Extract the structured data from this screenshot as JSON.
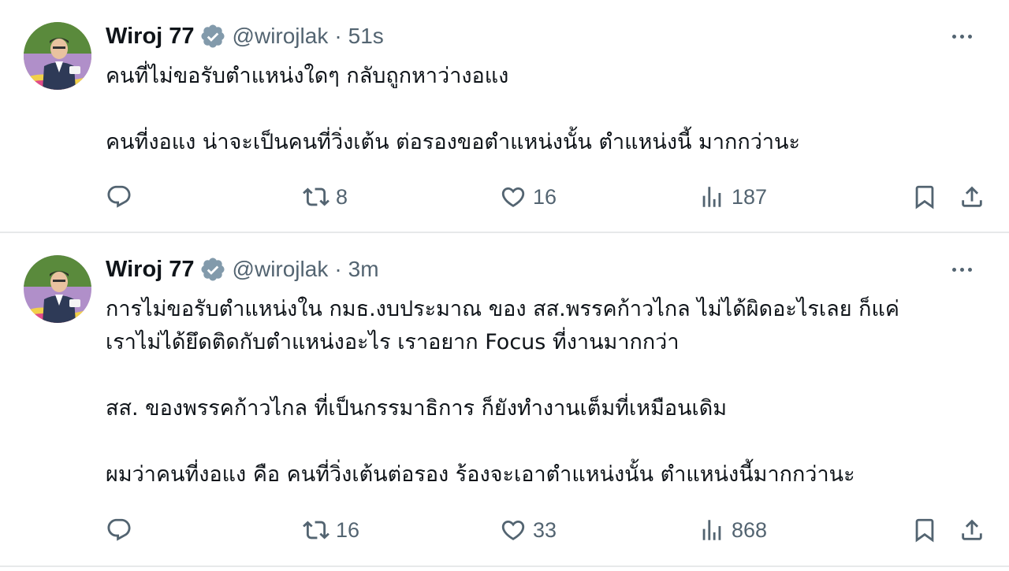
{
  "tweets": [
    {
      "author": {
        "name": "Wiroj 77",
        "handle": "@wirojlak",
        "separator": "·",
        "time": "51s"
      },
      "lines": [
        "คนที่ไม่ขอรับตำแหน่งใดๆ กลับถูกหาว่างอแง",
        "",
        "คนที่งอแง น่าจะเป็นคนที่วิ่งเต้น ต่อรองขอตำแหน่งนั้น ตำแหน่งนี้ มากกว่านะ"
      ],
      "stats": {
        "retweets": "8",
        "likes": "16",
        "views": "187"
      }
    },
    {
      "author": {
        "name": "Wiroj 77",
        "handle": "@wirojlak",
        "separator": "·",
        "time": "3m"
      },
      "lines": [
        "การไม่ขอรับตำแหน่งใน กมธ.งบประมาณ ของ สส.พรรคก้าวไกล ไม่ได้ผิดอะไรเลย ก็แค่",
        "เราไม่ได้ยึดติดกับตำแหน่งอะไร เราอยาก Focus ที่งานมากกว่า",
        "",
        "สส. ของพรรคก้าวไกล ที่เป็นกรรมาธิการ ก็ยังทำงานเต็มที่เหมือนเดิม",
        "",
        "ผมว่าคนที่งอแง คือ คนที่วิ่งเต้นต่อรอง ร้องจะเอาตำแหน่งนั้น ตำแหน่งนี้มากกว่านะ"
      ],
      "stats": {
        "retweets": "16",
        "likes": "33",
        "views": "868"
      }
    }
  ],
  "icons": {
    "reply": "speech-bubble-icon",
    "retweet": "retweet-arrows-icon",
    "like": "heart-icon",
    "views": "bar-chart-icon",
    "bookmark": "bookmark-icon",
    "share": "upload-arrow-icon",
    "more": "more-dots-icon",
    "verified": "verified-badge-icon"
  },
  "colors": {
    "text": "#0f1419",
    "secondary": "#536471",
    "verified_badge": "#829aab",
    "divider": "#e7e9ea"
  }
}
